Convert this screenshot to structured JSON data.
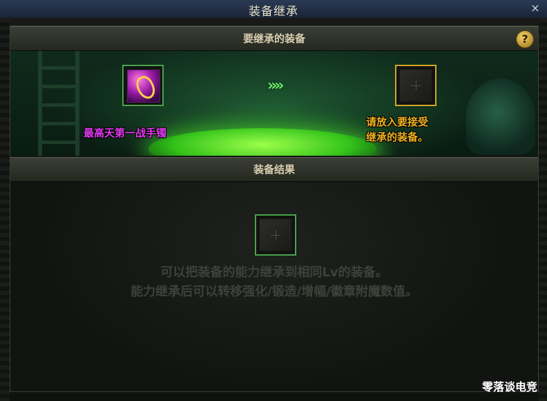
{
  "window": {
    "title": "装备继承",
    "close_label": "×"
  },
  "inherit_section": {
    "header": "要继承的装备",
    "help_label": "?"
  },
  "source_item": {
    "name": "最高天第一战手镯",
    "name_color": "#e23bf0"
  },
  "transfer": {
    "arrows": "»»"
  },
  "target_slot": {
    "hint_line1": "请放入要接受",
    "hint_line2": "继承的装备。",
    "hint_color": "#f0b21f"
  },
  "result_section": {
    "header": "装备结果",
    "desc_line1": "可以把装备的能力继承到相同Lv的装备。",
    "desc_line2": "能力继承后可以转移强化/锻造/增幅/徽章附魔数值。"
  },
  "watermark": "零落谈电竞",
  "colors": {
    "slot_border": "#4ca44b",
    "target_border": "#d5a826",
    "potion_glow": "#33c21a"
  }
}
